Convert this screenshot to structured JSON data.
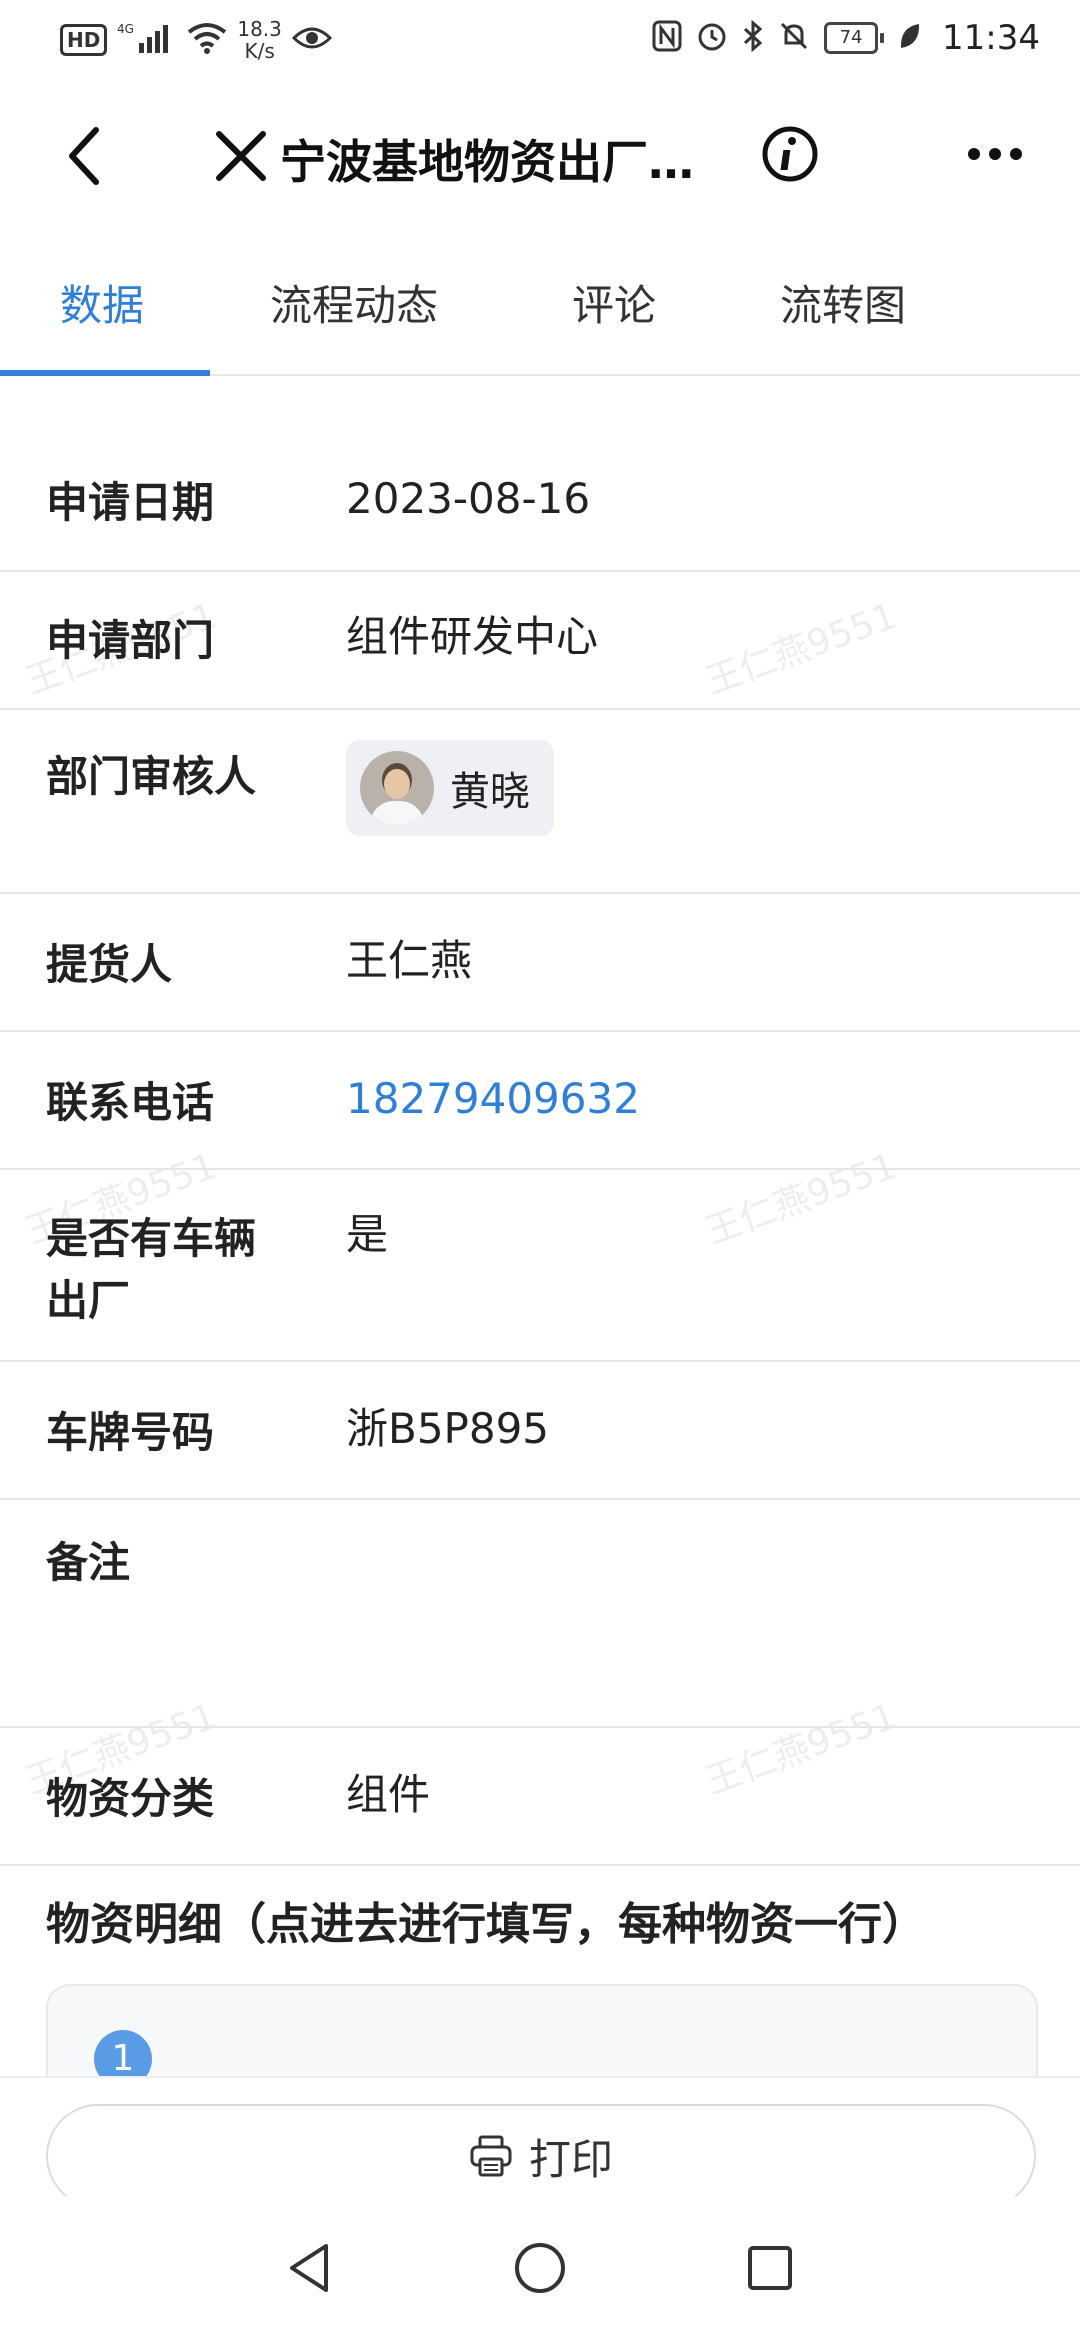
{
  "status_bar": {
    "hd": "HD",
    "network": "4G",
    "net_speed_value": "18.3",
    "net_speed_unit": "K/s",
    "battery": "74",
    "time": "11:34"
  },
  "header": {
    "title": "宁波基地物资出厂…",
    "icons": [
      "back-arrow-icon",
      "close-icon",
      "info-icon",
      "more-icon"
    ]
  },
  "tabs": [
    {
      "label": "数据",
      "active": true
    },
    {
      "label": "流程动态",
      "active": false
    },
    {
      "label": "评论",
      "active": false
    },
    {
      "label": "流转图",
      "active": false
    }
  ],
  "form": {
    "apply_date": {
      "label": "申请日期",
      "value": "2023-08-16"
    },
    "apply_dept": {
      "label": "申请部门",
      "value": "组件研发中心"
    },
    "dept_reviewer": {
      "label": "部门审核人",
      "value": "黄晓"
    },
    "picker": {
      "label": "提货人",
      "value": "王仁燕"
    },
    "phone": {
      "label": "联系电话",
      "value": "18279409632"
    },
    "vehicle_exit": {
      "label": "是否有车辆出厂",
      "value": "是"
    },
    "plate": {
      "label": "车牌号码",
      "value": "浙B5P895"
    },
    "remark": {
      "label": "备注",
      "value": ""
    },
    "category": {
      "label": "物资分类",
      "value": "组件"
    }
  },
  "detail": {
    "section_title": "物资明细（点进去进行填写，每种物资一行）",
    "first_index": "1"
  },
  "bottom": {
    "print_label": "打印"
  },
  "watermark": "王仁燕9551",
  "colors": {
    "accent": "#2f7fd7",
    "badge": "#5a9be6"
  }
}
